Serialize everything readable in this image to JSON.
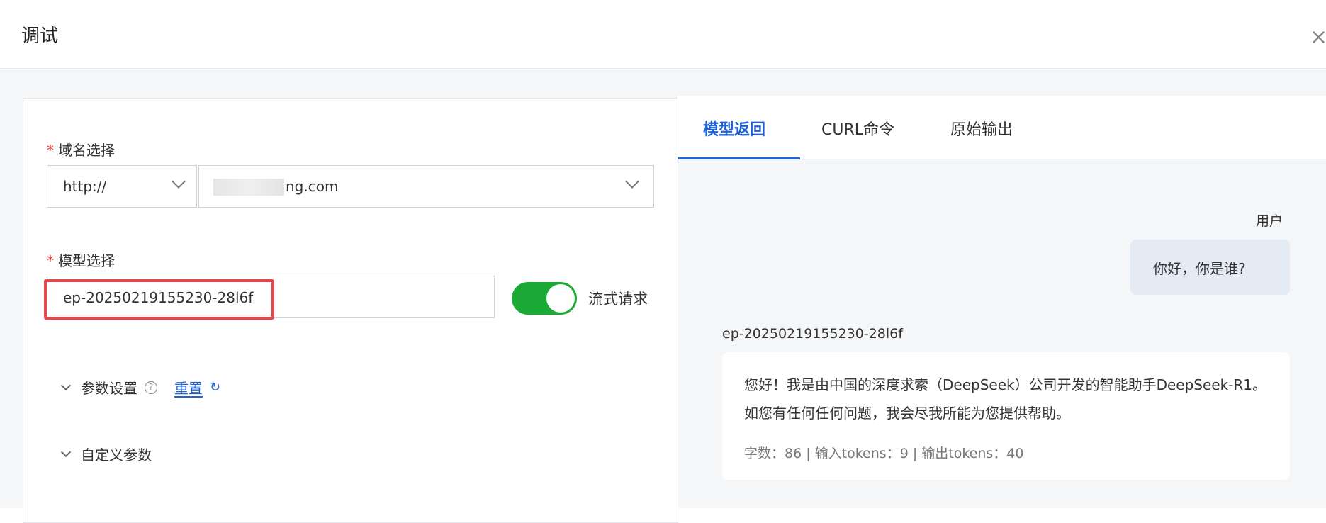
{
  "dialog": {
    "title": "调试",
    "close_symbol": "×"
  },
  "form": {
    "domain_label": "域名选择",
    "protocol_value": "http://",
    "domain_value": "ng.com",
    "model_label": "模型选择",
    "model_value": "ep-20250219155230-28l6f",
    "stream_toggle_label": "流式请求",
    "stream_enabled": true,
    "params_label": "参数设置",
    "reset_label": "重置",
    "custom_params_label": "自定义参数"
  },
  "tabs": [
    {
      "label": "模型返回",
      "active": true
    },
    {
      "label": "CURL命令",
      "active": false
    },
    {
      "label": "原始输出",
      "active": false
    }
  ],
  "chat": {
    "user_label": "用户",
    "user_message": "你好，你是谁?",
    "model_name": "ep-20250219155230-28l6f",
    "reply": "您好！我是由中国的深度求索（DeepSeek）公司开发的智能助手DeepSeek-R1。如您有任何任何问题，我会尽我所能为您提供帮助。",
    "stats": "字数：86 | 输入tokens：9 | 输出tokens：40"
  },
  "colors": {
    "accent": "#1f62d8",
    "toggle_on": "#1aaa35",
    "highlight": "#e5454b",
    "required": "#e83b3b"
  }
}
